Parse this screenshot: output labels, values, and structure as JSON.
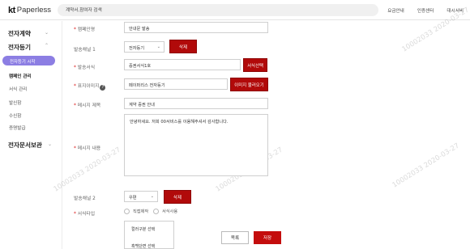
{
  "header": {
    "logo_mark": "kt",
    "logo_name": "Paperless",
    "search_placeholder": "계약서,참여자 검색",
    "links": [
      "요금안내",
      "인증센터",
      "대시서비"
    ]
  },
  "sidebar": {
    "categories": [
      {
        "label": "전자계약",
        "chevron": "chevron-down-icon"
      },
      {
        "label": "전자등기",
        "chevron": "chevron-up-icon"
      },
      {
        "label": "전자문서보관",
        "chevron": "chevron-down-icon"
      }
    ],
    "active_item": "전자등기 시작",
    "items": [
      "캠페인 관리",
      "서식 관리",
      "발신함",
      "수신함",
      "증명발급"
    ]
  },
  "form": {
    "campaign_label": "캠페인명",
    "campaign_value": "안내문 발송",
    "channel1_label": "발송채널 1",
    "channel1_value": "전자등기",
    "delete1_label": "삭제",
    "form_label": "발송서식",
    "form_value": "증권서식1호",
    "form_select_button": "서식선택",
    "display_image_label": "표지이미지",
    "display_image_value": "페이퍼리스 전자등기",
    "image_load_button": "이미지 불러오기",
    "msg_title_label": "메시지 제목",
    "msg_title_value": "계약 증권 안내",
    "msg_content_label": "메시지 내용",
    "msg_content_value": "안녕하세요. 저희 00서비스를 이용해주셔서 감사합니다.",
    "channel2_label": "발송채널 2",
    "channel2_value": "우편",
    "delete2_label": "삭제",
    "form_type_label": "서식타입",
    "radio_options": [
      "직접제작",
      "서식사용"
    ],
    "dropdown_options": [
      "컬러구분 선택",
      "흑백단면 선택"
    ],
    "cancel_label": "목록",
    "save_label": "저장"
  },
  "watermarks": [
    "10002033 2020-03-27"
  ],
  "colors": {
    "accent_red": "#b10a0a",
    "sidebar_active": "#8c7ee3"
  }
}
